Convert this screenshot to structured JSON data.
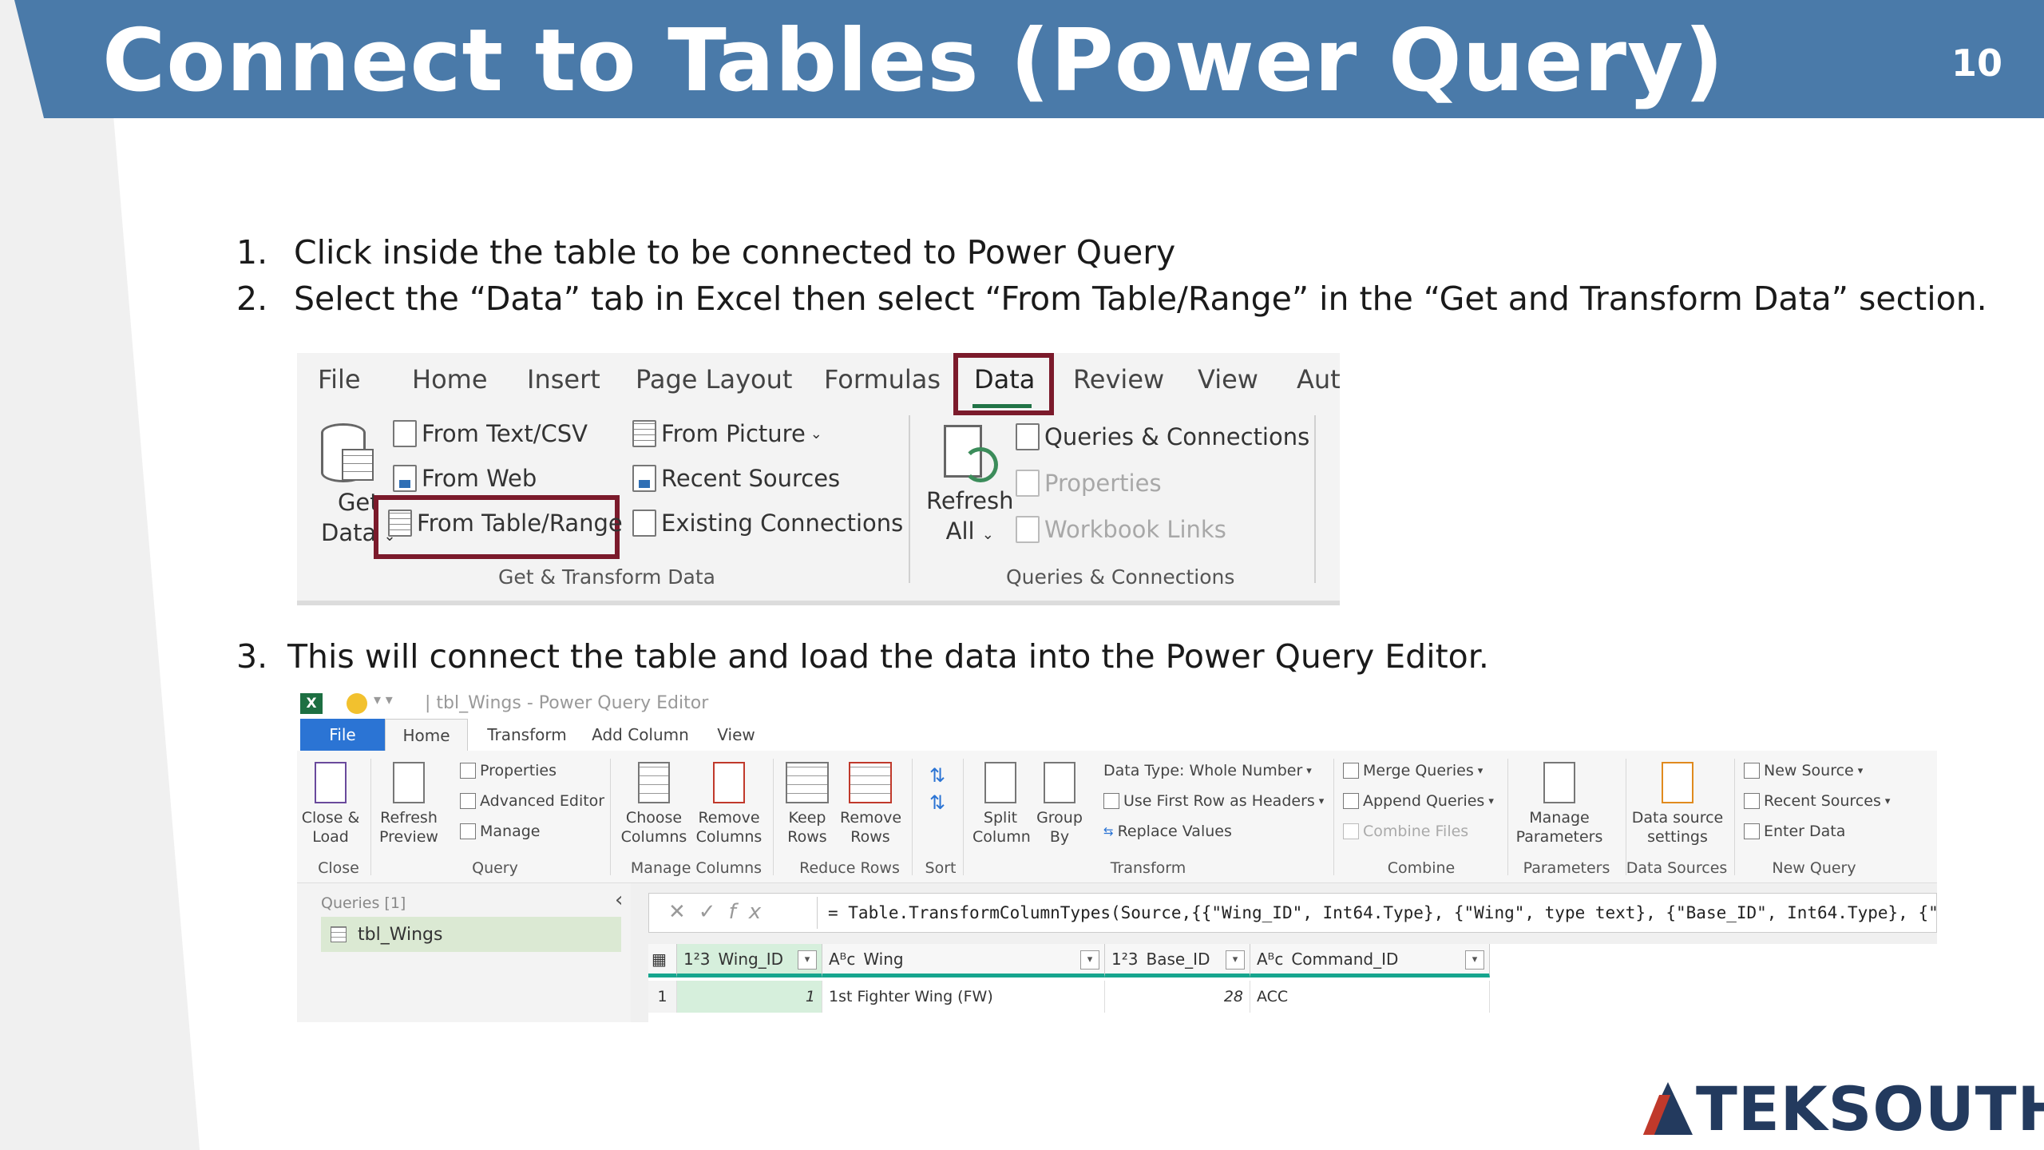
{
  "slide": {
    "title": "Connect to Tables (Power Query)",
    "number": "10",
    "colors": {
      "header": "#4a7aa9",
      "highlight_box": "#7b1a2b",
      "excel_green": "#217346"
    }
  },
  "steps": [
    {
      "num": "1.",
      "text": "Click inside the table to be connected to Power Query"
    },
    {
      "num": "2.",
      "text": "Select the “Data” tab in Excel then select “From Table/Range” in the “Get and Transform Data” section."
    },
    {
      "num": "3.",
      "text": "This will connect the table and load the data into the Power Query Editor."
    }
  ],
  "excel_ribbon": {
    "tabs": [
      "File",
      "Home",
      "Insert",
      "Page Layout",
      "Formulas",
      "Data",
      "Review",
      "View",
      "Aut"
    ],
    "active_tab": "Data",
    "get_data": {
      "line1": "Get",
      "line2": "Data"
    },
    "items": {
      "from_text_csv": "From Text/CSV",
      "from_web": "From Web",
      "from_table_range": "From Table/Range",
      "from_picture": "From Picture",
      "recent_sources": "Recent Sources",
      "existing_connections": "Existing Connections",
      "queries_connections": "Queries & Connections",
      "properties": "Properties",
      "workbook_links": "Workbook Links"
    },
    "refresh": {
      "line1": "Refresh",
      "line2": "All"
    },
    "groups": {
      "get_transform": "Get & Transform Data",
      "queries_connections": "Queries & Connections"
    }
  },
  "power_query": {
    "window_title": "| tbl_Wings - Power Query Editor",
    "tabs": [
      "File",
      "Home",
      "Transform",
      "Add Column",
      "View"
    ],
    "ribbon": {
      "close_load": [
        "Close &",
        "Load"
      ],
      "refresh_preview": [
        "Refresh",
        "Preview"
      ],
      "properties": "Properties",
      "advanced_editor": "Advanced Editor",
      "manage": "Manage",
      "choose_columns": [
        "Choose",
        "Columns"
      ],
      "remove_columns": [
        "Remove",
        "Columns"
      ],
      "keep_rows": [
        "Keep",
        "Rows"
      ],
      "remove_rows": [
        "Remove",
        "Rows"
      ],
      "split_column": [
        "Split",
        "Column"
      ],
      "group_by": [
        "Group",
        "By"
      ],
      "data_type": "Data Type: Whole Number",
      "use_first_row": "Use First Row as Headers",
      "replace_values": "Replace Values",
      "merge_queries": "Merge Queries",
      "append_queries": "Append Queries",
      "combine_files": "Combine Files",
      "manage_parameters": [
        "Manage",
        "Parameters"
      ],
      "data_source_settings": [
        "Data source",
        "settings"
      ],
      "new_source": "New Source",
      "recent_sources": "Recent Sources",
      "enter_data": "Enter Data"
    },
    "groups": [
      "Close",
      "Query",
      "Manage Columns",
      "Reduce Rows",
      "Sort",
      "Transform",
      "Combine",
      "Parameters",
      "Data Sources",
      "New Query"
    ],
    "queries_header": "Queries [1]",
    "query_item": "tbl_Wings",
    "formula": "= Table.TransformColumnTypes(Source,{{\"Wing_ID\", Int64.Type}, {\"Wing\", type text}, {\"Base_ID\", Int64.Type}, {\"Co",
    "columns": [
      {
        "type": "1²3",
        "name": "Wing_ID"
      },
      {
        "type": "Aᴮc",
        "name": "Wing"
      },
      {
        "type": "1²3",
        "name": "Base_ID"
      },
      {
        "type": "Aᴮc",
        "name": "Command_ID"
      }
    ],
    "rows": [
      {
        "index": "1",
        "Wing_ID": "1",
        "Wing": "1st Fighter Wing (FW)",
        "Base_ID": "28",
        "Command_ID": "ACC"
      }
    ]
  },
  "logo": {
    "text": "TEKSOUTH"
  }
}
